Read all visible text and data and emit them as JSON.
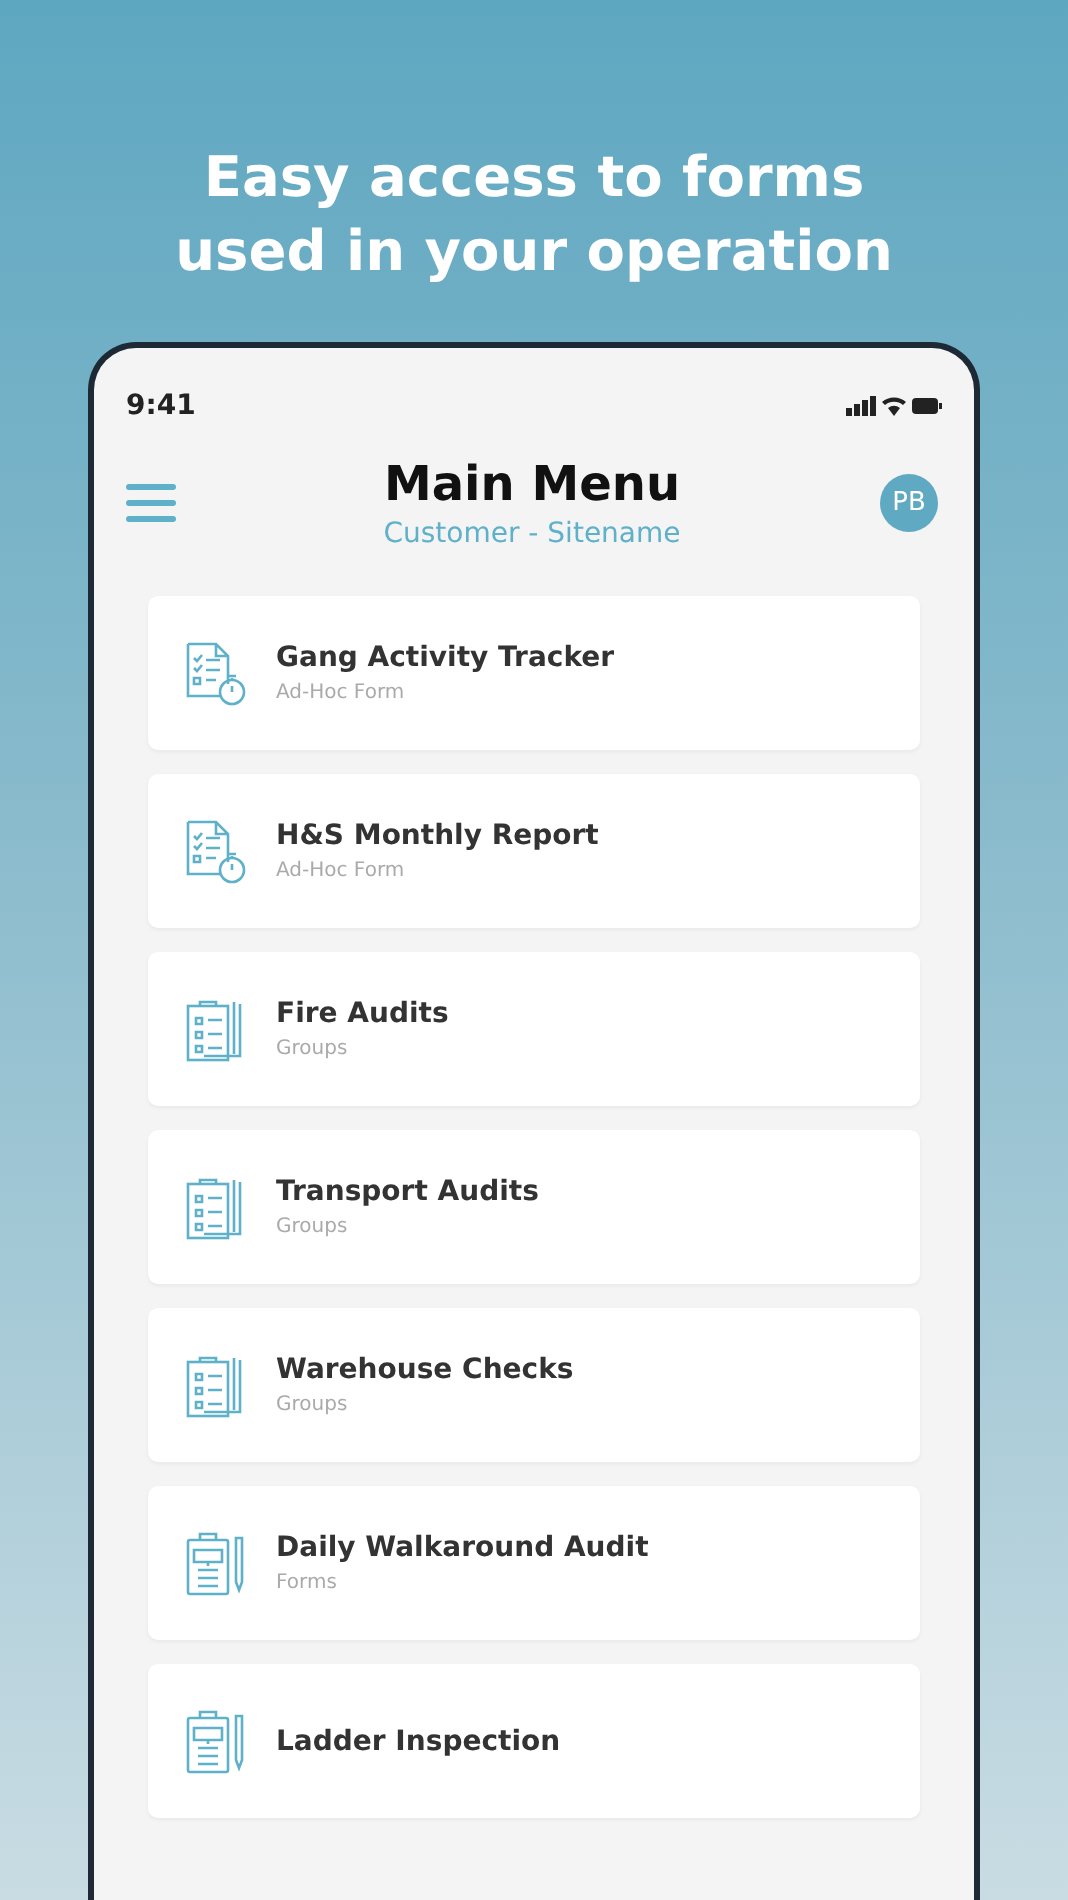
{
  "headline": "Easy access to forms used in your operation",
  "status_bar": {
    "time": "9:41"
  },
  "header": {
    "title": "Main Menu",
    "subtitle": "Customer - Sitename",
    "avatar": "PB"
  },
  "items": [
    {
      "title": "Gang Activity Tracker",
      "subtitle": "Ad-Hoc Form",
      "kind": "form"
    },
    {
      "title": "H&S Monthly Report",
      "subtitle": "Ad-Hoc Form",
      "kind": "form"
    },
    {
      "title": "Fire Audits",
      "subtitle": "Groups",
      "kind": "group"
    },
    {
      "title": "Transport Audits",
      "subtitle": "Groups",
      "kind": "group"
    },
    {
      "title": "Warehouse Checks",
      "subtitle": "Groups",
      "kind": "group"
    },
    {
      "title": "Daily Walkaround Audit",
      "subtitle": "Forms",
      "kind": "audit"
    },
    {
      "title": "Ladder Inspection",
      "kind": "audit"
    }
  ]
}
